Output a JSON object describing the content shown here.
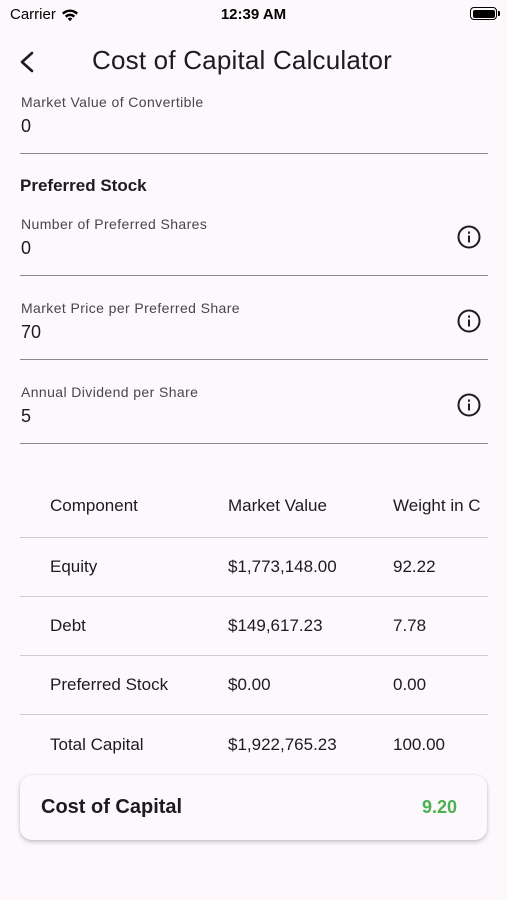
{
  "status_bar": {
    "carrier": "Carrier",
    "time": "12:39 AM",
    "wifi_icon": "wifi-icon",
    "battery_icon": "battery-icon"
  },
  "app_bar": {
    "title": "Cost of Capital Calculator",
    "back_icon": "chevron-left-icon"
  },
  "fields": {
    "convertible": {
      "label": "Market Value of Convertible",
      "value": "0"
    },
    "preferred_section": "Preferred Stock",
    "preferred_shares": {
      "label": "Number of Preferred Shares",
      "value": "0"
    },
    "preferred_price": {
      "label": "Market Price per Preferred Share",
      "value": "70"
    },
    "annual_dividend": {
      "label": "Annual Dividend per Share",
      "value": "5"
    }
  },
  "table": {
    "headers": [
      "Component",
      "Market Value",
      "Weight in C"
    ],
    "rows": [
      [
        "Equity",
        "$1,773,148.00",
        "92.22"
      ],
      [
        "Debt",
        "$149,617.23",
        "7.78"
      ],
      [
        "Preferred Stock",
        "$0.00",
        "0.00"
      ],
      [
        "Total Capital",
        "$1,922,765.23",
        "100.00"
      ]
    ]
  },
  "result": {
    "label": "Cost of Capital",
    "value": "9.20",
    "value_color": "#4caf50"
  },
  "colors": {
    "background": "#fcf8fc",
    "text": "#1c1b1f",
    "underline": "#8a8a8f"
  }
}
